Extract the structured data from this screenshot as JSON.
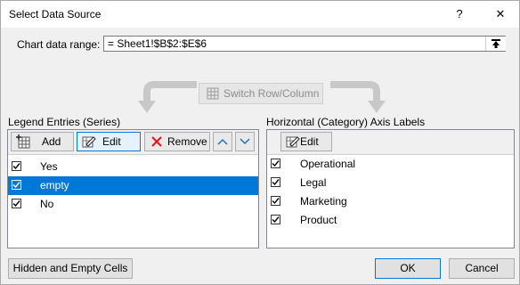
{
  "window": {
    "title": "Select Data Source",
    "help_glyph": "?",
    "close_glyph": "✕"
  },
  "range": {
    "label": "Chart data range:",
    "value": "= Sheet1!$B$2:$E$6"
  },
  "switch_button": {
    "label": "Switch Row/Column"
  },
  "legend": {
    "header": "Legend Entries (Series)",
    "add_label": "Add",
    "edit_label": "Edit",
    "remove_label": "Remove",
    "items": [
      {
        "label": "Yes",
        "checked": true,
        "selected": false
      },
      {
        "label": "empty",
        "checked": true,
        "selected": true
      },
      {
        "label": "No",
        "checked": true,
        "selected": false
      }
    ]
  },
  "axis": {
    "header": "Horizontal (Category) Axis Labels",
    "edit_label": "Edit",
    "items": [
      {
        "label": "Operational",
        "checked": true
      },
      {
        "label": "Legal",
        "checked": true
      },
      {
        "label": "Marketing",
        "checked": true
      },
      {
        "label": "Product",
        "checked": true
      }
    ]
  },
  "footer": {
    "hidden_cells_label": "Hidden and Empty Cells",
    "ok_label": "OK",
    "cancel_label": "Cancel"
  },
  "colors": {
    "selection": "#0078d7",
    "arrow": "#c8c8c8",
    "red_x": "#e81123",
    "blue_chevron": "#1e6fd0"
  }
}
